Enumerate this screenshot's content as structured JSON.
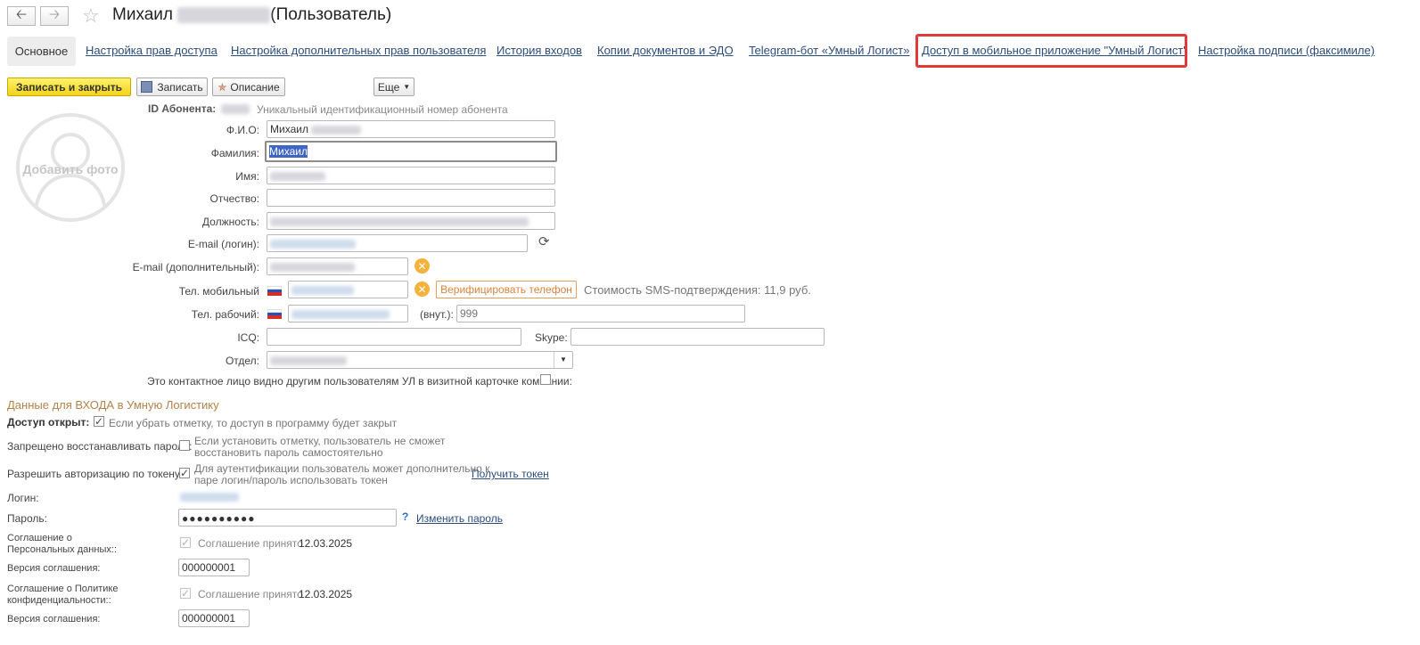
{
  "window": {
    "title_first_name": "Михаил",
    "title_suffix": "(Пользователь)",
    "back_icon": "arrow-left-icon",
    "forward_icon": "arrow-right-icon",
    "favorite_icon": "star-icon"
  },
  "tabs": {
    "active": "Основное",
    "items": [
      "Настройка прав доступа",
      "Настройка дополнительных прав пользователя",
      "История входов",
      "Копии документов и ЭДО",
      "Telegram-бот «Умный Логист»",
      "Доступ в мобильное приложение \"Умный Логист\"",
      "Настройка подписи (факсимиле)"
    ],
    "highlight_color": "#e03a3a"
  },
  "toolbar": {
    "save_close": "Записать и закрыть",
    "save": "Записать",
    "description": "Описание",
    "more": "Еще"
  },
  "photo": {
    "label": "Добавить фото"
  },
  "form": {
    "id_label": "ID Абонента:",
    "id_hint": "Уникальный идентификационный номер абонента",
    "fio_label": "Ф.И.О:",
    "fio_value": "Михаил",
    "surname_label": "Фамилия:",
    "surname_value": "Михаил",
    "name_label": "Имя:",
    "patronymic_label": "Отчество:",
    "position_label": "Должность:",
    "email_login_label": "E-mail (логин):",
    "email_extra_label": "E-mail (дополнительный):",
    "mobile_label": "Тел. мобильный",
    "verify_button": "Верифицировать телефон",
    "sms_cost": "Стоимость SMS-подтверждения:  11,9 руб.",
    "work_phone_label": "Тел. рабочий:",
    "ext_label": "(внут.):",
    "ext_placeholder": "999",
    "icq_label": "ICQ:",
    "skype_label": "Skype:",
    "department_label": "Отдел:",
    "visible_contact_label": "Это контактное лицо видно другим пользователям УЛ в визитной карточке компании:"
  },
  "login_section": {
    "title": "Данные для ВХОДА в Умную Логистику",
    "access_label": "Доступ открыт:",
    "access_hint": "Если убрать отметку, то доступ в программу будет закрыт",
    "forbid_restore_label": "Запрещено восстанавливать пароль:",
    "forbid_restore_hint_1": "Если установить отметку, пользователь не сможет",
    "forbid_restore_hint_2": "восстановить пароль самостоятельно",
    "token_label": "Разрешить авторизацию по токену:",
    "token_hint_1": "Для аутентификации пользователь может дополнительно к",
    "token_hint_2": "паре логин/пароль использовать токен",
    "get_token": "Получить токен",
    "login_label": "Логин:",
    "password_label": "Пароль:",
    "password_value": "●●●●●●●●●●",
    "help_mark": "?",
    "change_password": "Изменить пароль",
    "pd_agreement_label_1": "Соглашение о",
    "pd_agreement_label_2": "Персональных данных::",
    "agreement_accepted": "Соглашение принято",
    "pd_agreement_date": "12.03.2025",
    "version_label": "Версия соглашения:",
    "pd_version": "000000001",
    "privacy_label_1": "Соглашение о Политике",
    "privacy_label_2": "конфиденциальности::",
    "privacy_date": "12.03.2025",
    "privacy_version": "000000001"
  }
}
